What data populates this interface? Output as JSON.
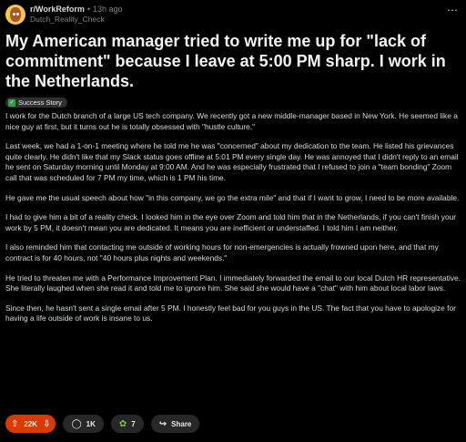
{
  "header": {
    "subreddit": "r/WorkReform",
    "separator": "•",
    "age": "13h ago",
    "username": "Dutch_Reality_Check",
    "more_icon": "ellipsis-icon"
  },
  "post": {
    "title": "My American manager tried to write me up for \"lack of commitment\" because I leave at 5:00 PM sharp. I work in the Netherlands.",
    "flair": "Success Story",
    "paragraphs": [
      "I work for the Dutch branch of a large US tech company. We recently got a new middle-manager based in New York. He seemed like a nice guy at first, but it turns out he is totally obsessed with \"hustle culture.\"",
      "Last week, we had a 1-on-1 meeting where he told me he was \"concerned\" about my dedication to the team. He listed his grievances quite clearly. He didn't like that my Slack status goes offline at 5:01 PM every single day. He was annoyed that I didn't reply to an email he sent on Saturday morning until Monday at 9:00 AM. And he was especially frustrated that I refused to join a \"team bonding\" Zoom call that was scheduled for 7 PM my time, which is 1 PM his time.",
      "He gave me the usual speech about how \"in this company, we go the extra mile\" and that if I want to grow, I need to be more available.",
      "I had to give him a bit of a reality check. I looked him in the eye over Zoom and told him that in the Netherlands, if you can't finish your work by 5 PM, it doesn't mean you are dedicated. It means you are inefficient or understaffed. I told him I am neither.",
      "I also reminded him that contacting me outside of working hours for non-emergencies is actually frowned upon here, and that my contract is for 40 hours, not \"40 hours plus nights and weekends.\"",
      "He tried to threaten me with a Performance Improvement Plan. I immediately forwarded the email to our local Dutch HR representative. She literally laughed when she read it and told me to ignore him. She said she would have a \"chat\" with him about local labor laws.",
      "Since then, he hasn't sent a single email after 5 PM. I honestly feel bad for you guys in the US. The fact that you have to apologize for having a life outside of work is insane to us."
    ]
  },
  "actions": {
    "upvotes": "22K",
    "comments": "1K",
    "awards": "7",
    "share": "Share"
  },
  "colors": {
    "background": "#000000",
    "upvote_pill": "#d93a00",
    "flair_check": "#2ea043"
  }
}
